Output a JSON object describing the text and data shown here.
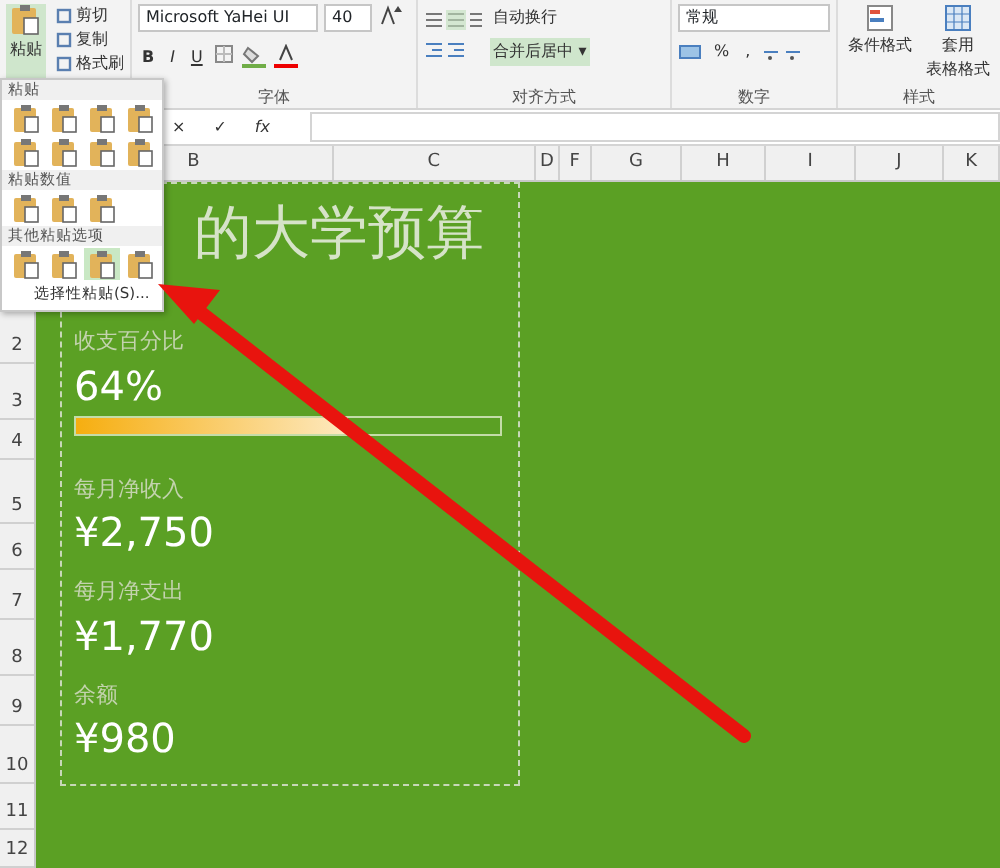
{
  "ribbon": {
    "clipboard": {
      "paste": "粘贴",
      "cut": "剪切",
      "copy": "复制",
      "format_painter": "格式刷"
    },
    "font": {
      "name": "Microsoft YaHei UI",
      "size": "40",
      "bold": "B",
      "italic": "I",
      "underline": "U",
      "label": "字体"
    },
    "alignment": {
      "wrap": "自动换行",
      "merge": "合并后居中",
      "merge_caret": "▾",
      "label": "对齐方式"
    },
    "number": {
      "format": "常规",
      "percent": "%",
      "comma": ",",
      "label": "数字"
    },
    "styles": {
      "conditional": "条件格式",
      "table": [
        "套用",
        "表格格式"
      ],
      "label": "样式"
    }
  },
  "formula_bar": {
    "cancel": "×",
    "enter": "✓",
    "function": "fx"
  },
  "columns": [
    {
      "label": "B"
    },
    {
      "label": "C"
    },
    {
      "label": "D"
    },
    {
      "label": "F"
    },
    {
      "label": "G"
    },
    {
      "label": "H"
    },
    {
      "label": "I"
    },
    {
      "label": "J"
    },
    {
      "label": "K"
    }
  ],
  "rows": [
    "2",
    "3",
    "4",
    "5",
    "6",
    "7",
    "8",
    "9",
    "10",
    "11",
    "12"
  ],
  "sheet": {
    "title": "的大学预算",
    "percent": {
      "label": "收支百分比",
      "value": "64%",
      "level": 0.64
    },
    "amounts": [
      {
        "label": "每月净收入",
        "value": "¥2,750"
      },
      {
        "label": "每月净支出",
        "value": "¥1,770"
      },
      {
        "label": "余额",
        "value": "¥980"
      }
    ]
  },
  "paste_menu": {
    "sections": [
      {
        "title": "粘贴",
        "options": [
          {
            "selected": false
          },
          {
            "selected": false
          },
          {
            "selected": false
          },
          {
            "selected": false
          },
          {
            "selected": false
          },
          {
            "selected": false
          },
          {
            "selected": false
          },
          {
            "selected": false
          }
        ]
      },
      {
        "title": "粘贴数值",
        "options": [
          {
            "selected": false
          },
          {
            "selected": false
          },
          {
            "selected": false
          }
        ]
      },
      {
        "title": "其他粘贴选项",
        "options": [
          {
            "selected": false
          },
          {
            "selected": false
          },
          {
            "selected": true
          },
          {
            "selected": false
          }
        ]
      }
    ],
    "special": "选择性粘贴(S)..."
  }
}
